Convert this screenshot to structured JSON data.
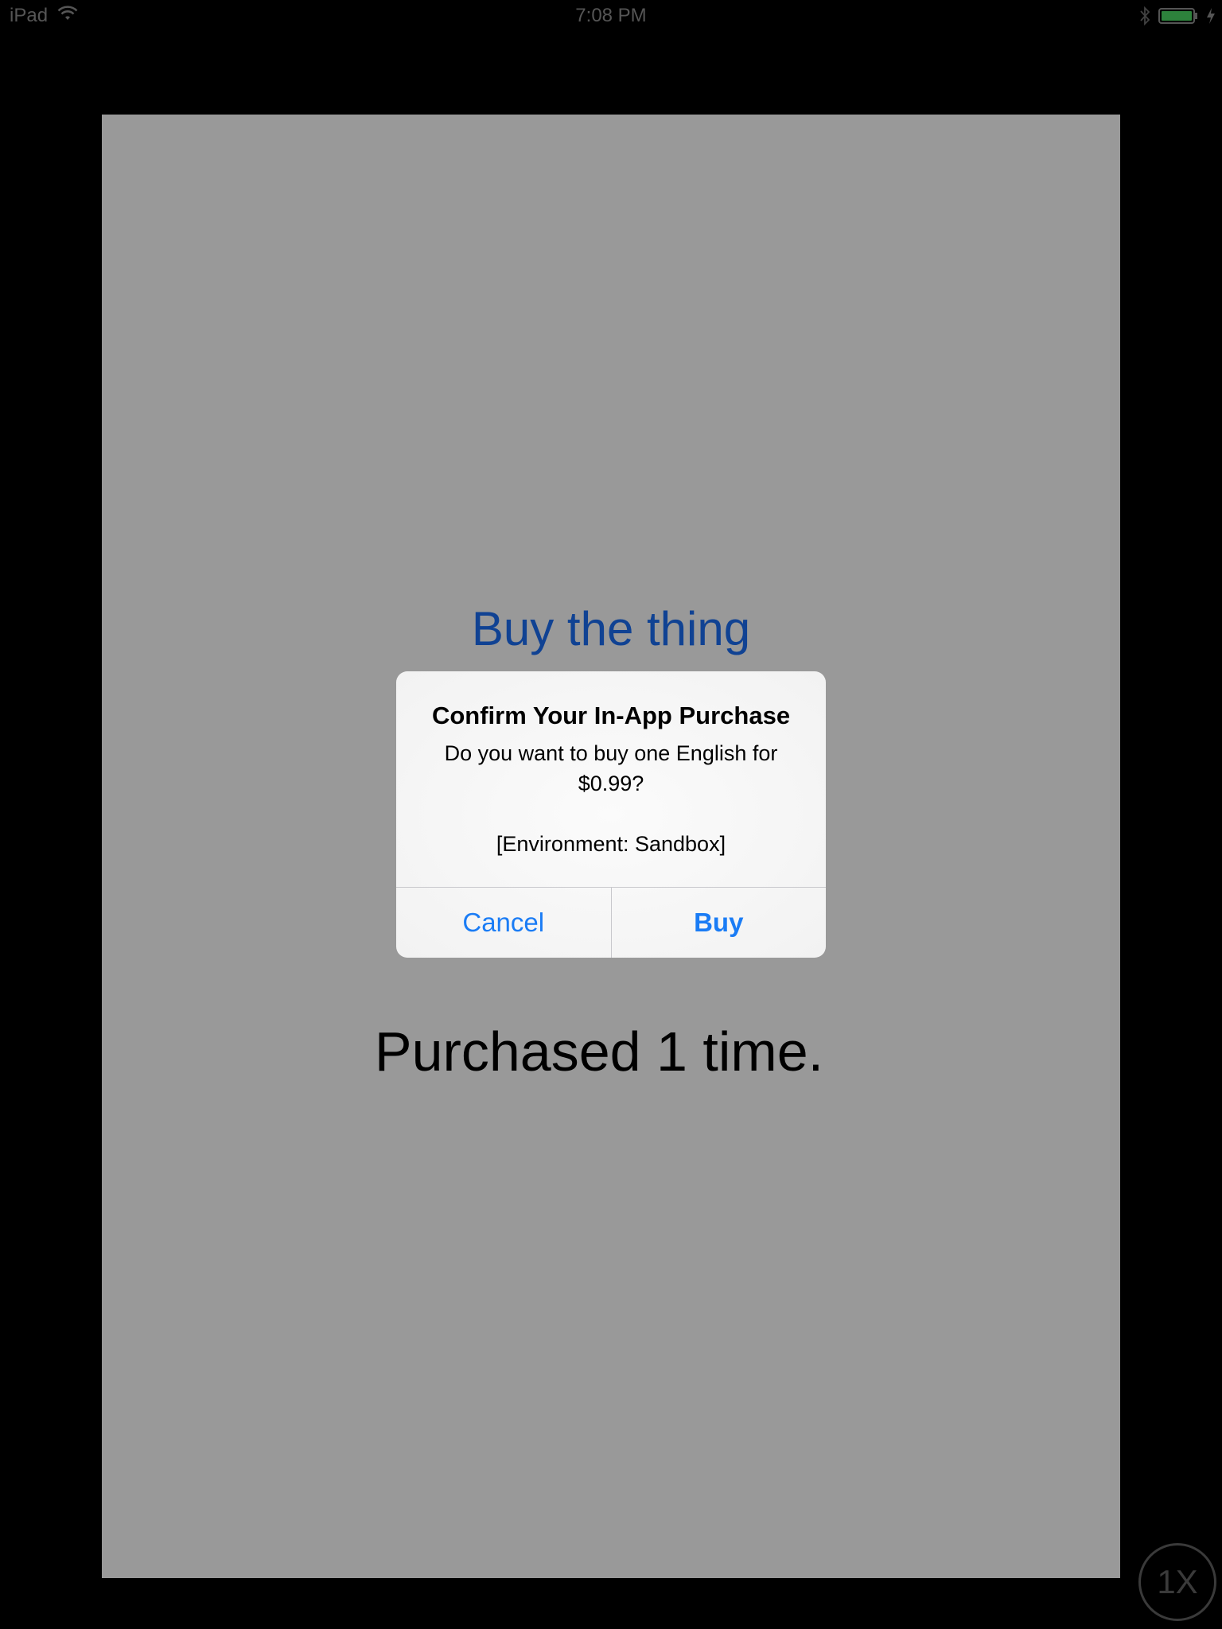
{
  "status_bar": {
    "device": "iPad",
    "time": "7:08 PM",
    "icons": [
      "wifi-icon",
      "bluetooth-icon",
      "battery-icon",
      "charging-icon"
    ]
  },
  "app": {
    "buy_button_label": "Buy the thing",
    "purchased_label": "Purchased 1 time."
  },
  "alert": {
    "title": "Confirm Your In-App Purchase",
    "message": "Do you want to buy one English for $0.99?",
    "environment": "[Environment: Sandbox]",
    "cancel_label": "Cancel",
    "buy_label": "Buy"
  },
  "zoom_badge": {
    "label": "1X"
  },
  "colors": {
    "accent": "#1a7cf5",
    "battery": "#4cd964",
    "background": "#000000",
    "app_background": "#ffffff"
  }
}
